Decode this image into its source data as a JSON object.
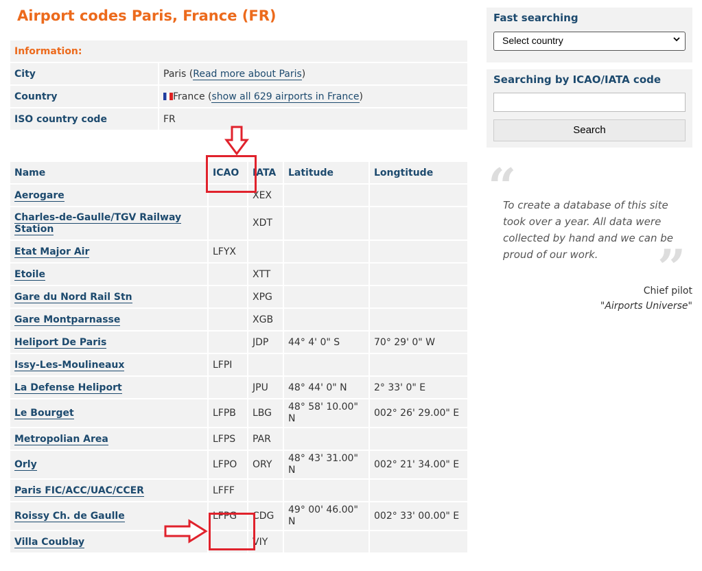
{
  "page_title": "Airport codes Paris, France (FR)",
  "info": {
    "heading": "Information:",
    "city_label": "City",
    "city_value": "Paris",
    "city_link": "Read more about Paris",
    "country_label": "Country",
    "country_value": "France",
    "country_link": "show all 629 airports in France",
    "iso_label": "ISO country code",
    "iso_value": "FR"
  },
  "airports": {
    "columns": [
      "Name",
      "ICAO",
      "IATA",
      "Latitude",
      "Longtitude"
    ],
    "rows": [
      {
        "name": "Aerogare",
        "icao": "",
        "iata": "XEX",
        "lat": "",
        "lon": ""
      },
      {
        "name": "Charles-de-Gaulle/TGV Railway Station",
        "icao": "",
        "iata": "XDT",
        "lat": "",
        "lon": ""
      },
      {
        "name": "Etat Major Air",
        "icao": "LFYX",
        "iata": "",
        "lat": "",
        "lon": ""
      },
      {
        "name": "Etoile",
        "icao": "",
        "iata": "XTT",
        "lat": "",
        "lon": ""
      },
      {
        "name": "Gare du Nord Rail Stn",
        "icao": "",
        "iata": "XPG",
        "lat": "",
        "lon": ""
      },
      {
        "name": "Gare Montparnasse",
        "icao": "",
        "iata": "XGB",
        "lat": "",
        "lon": ""
      },
      {
        "name": "Heliport De Paris",
        "icao": "",
        "iata": "JDP",
        "lat": "44° 4' 0\" S",
        "lon": "70° 29' 0\" W"
      },
      {
        "name": "Issy-Les-Moulineaux",
        "icao": "LFPI",
        "iata": "",
        "lat": "",
        "lon": ""
      },
      {
        "name": "La Defense Heliport",
        "icao": "",
        "iata": "JPU",
        "lat": "48° 44' 0\" N",
        "lon": "2° 33' 0\" E"
      },
      {
        "name": "Le Bourget",
        "icao": "LFPB",
        "iata": "LBG",
        "lat": "48° 58' 10.00\" N",
        "lon": "002° 26' 29.00\" E"
      },
      {
        "name": "Metropolian Area",
        "icao": "LFPS",
        "iata": "PAR",
        "lat": "",
        "lon": ""
      },
      {
        "name": "Orly",
        "icao": "LFPO",
        "iata": "ORY",
        "lat": "48° 43' 31.00\" N",
        "lon": "002° 21' 34.00\" E"
      },
      {
        "name": "Paris FIC/ACC/UAC/CCER",
        "icao": "LFFF",
        "iata": "",
        "lat": "",
        "lon": ""
      },
      {
        "name": "Roissy Ch. de Gaulle",
        "icao": "LFPG",
        "iata": "CDG",
        "lat": "49° 00' 46.00\" N",
        "lon": "002° 33' 00.00\" E"
      },
      {
        "name": "Villa Coublay",
        "icao": "",
        "iata": "VIY",
        "lat": "",
        "lon": ""
      }
    ]
  },
  "sidebar": {
    "fast_search_title": "Fast searching",
    "country_select_value": "Select country",
    "code_search_title": "Searching by ICAO/IATA code",
    "code_input_value": "",
    "search_button": "Search"
  },
  "quote": {
    "text": "To create a database of this site took over a year. All data were collected by hand and we can be proud of our work.",
    "author": "Chief pilot",
    "organization": "\"Airports Universe\""
  },
  "colors": {
    "title": "#ec6a1c",
    "label": "#1d4a6e",
    "highlight": "#e0222c",
    "cell_bg": "#f2f2f2"
  }
}
